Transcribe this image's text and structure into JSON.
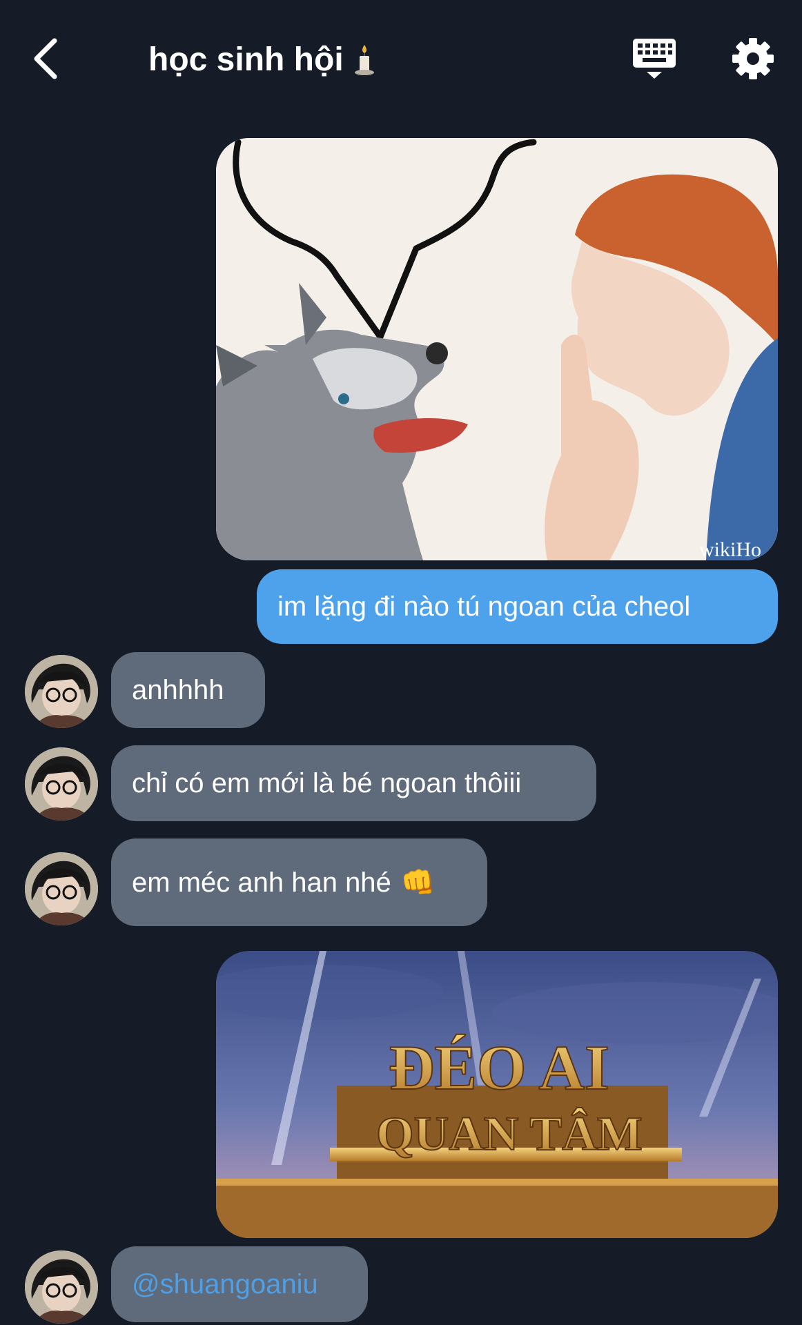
{
  "header": {
    "title": "học sinh hội",
    "back_icon": "chevron-left-icon",
    "keyboard_icon": "keyboard-icon",
    "settings_icon": "gear-icon"
  },
  "messages": [
    {
      "type": "image",
      "direction": "sent",
      "image": "dog-shush-meme",
      "watermark": "wikiHo"
    },
    {
      "type": "text",
      "direction": "sent",
      "text": "im lặng đi nào tú ngoan của cheol"
    },
    {
      "type": "text",
      "direction": "received",
      "text": "anhhhh"
    },
    {
      "type": "text",
      "direction": "received",
      "text": "chỉ có em mới là bé ngoan thôiii"
    },
    {
      "type": "text",
      "direction": "received",
      "text": "em méc anh han nhé",
      "emoji": "👊"
    },
    {
      "type": "image",
      "direction": "sent",
      "image": "deo-ai-quan-tam-meme",
      "line1": "ĐÉO AI",
      "line2": "QUAN TÂM"
    },
    {
      "type": "text",
      "direction": "received",
      "text": "@shuangoaniu",
      "is_mention": true
    }
  ],
  "colors": {
    "background": "#151c28",
    "sent_bubble": "#4ea2ec",
    "received_bubble": "#5f6b7b",
    "mention": "#4e9fe6"
  }
}
